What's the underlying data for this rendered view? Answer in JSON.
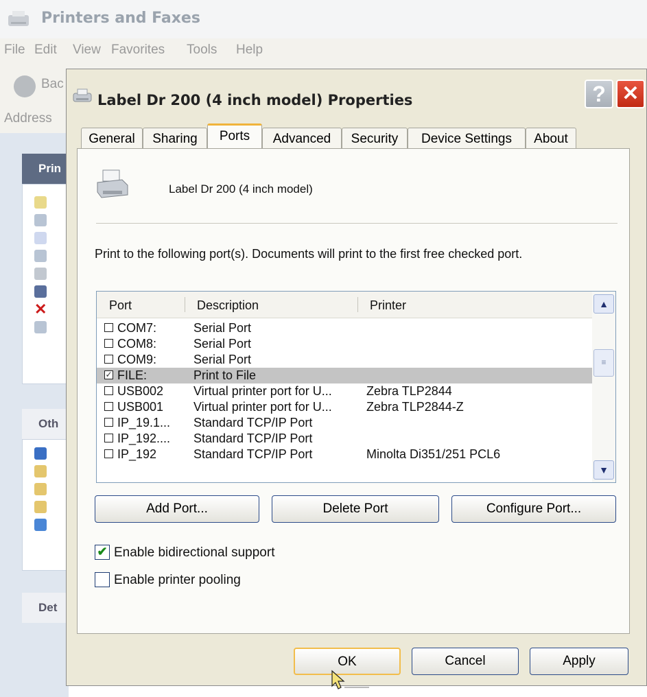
{
  "background_window": {
    "title": "Printers and Faxes",
    "menu": [
      "File",
      "Edit",
      "View",
      "Favorites",
      "Tools",
      "Help"
    ],
    "back_label": "Bac",
    "address_label": "Address",
    "panels": [
      {
        "header": "Prin"
      },
      {
        "header": "Oth"
      },
      {
        "header": "Det"
      }
    ]
  },
  "dialog": {
    "title": "Label Dr 200 (4 inch model) Properties",
    "help_label": "?",
    "close_label": "✕",
    "tabs": [
      "General",
      "Sharing",
      "Ports",
      "Advanced",
      "Security",
      "Device Settings",
      "About"
    ],
    "active_tab": "Ports",
    "printer_name": "Label Dr 200 (4 inch model)",
    "description": "Print to the following port(s). Documents will print to the first free checked port.",
    "list": {
      "columns": [
        "Port",
        "Description",
        "Printer"
      ],
      "rows": [
        {
          "checked": "",
          "port": "COM7:",
          "description": "Serial Port",
          "printer": ""
        },
        {
          "checked": "",
          "port": "COM8:",
          "description": "Serial Port",
          "printer": ""
        },
        {
          "checked": "",
          "port": "COM9:",
          "description": "Serial Port",
          "printer": ""
        },
        {
          "checked": "✓",
          "port": "FILE:",
          "description": "Print to File",
          "printer": ""
        },
        {
          "checked": "",
          "port": "USB002",
          "description": "Virtual printer port for U...",
          "printer": "Zebra  TLP2844"
        },
        {
          "checked": "",
          "port": "USB001",
          "description": "Virtual printer port for U...",
          "printer": "Zebra  TLP2844-Z"
        },
        {
          "checked": "",
          "port": "IP_19.1...",
          "description": "Standard TCP/IP Port",
          "printer": ""
        },
        {
          "checked": "",
          "port": "IP_192....",
          "description": "Standard TCP/IP Port",
          "printer": ""
        },
        {
          "checked": "",
          "port": "IP_192",
          "description": "Standard TCP/IP Port",
          "printer": "Minolta Di351/251 PCL6"
        }
      ],
      "scroll_up": "▲",
      "scroll_down": "▼",
      "thumb_grip": "≡"
    },
    "buttons": {
      "add_port": "Add Port...",
      "delete_port": "Delete Port",
      "configure_port": "Configure Port..."
    },
    "bidirectional": {
      "label": "Enable bidirectional support",
      "checked": "✔"
    },
    "pooling": {
      "label": "Enable printer pooling",
      "checked": ""
    },
    "footer": {
      "ok": "OK",
      "cancel": "Cancel",
      "apply": "Apply"
    }
  },
  "colors": {
    "selected_row": "#c4c4c4",
    "focus_border": "#f2bd4b",
    "close_red": "#d8402a",
    "check_green": "#1a8a1a"
  }
}
